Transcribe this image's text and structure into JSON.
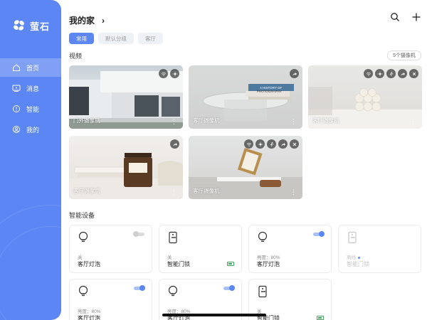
{
  "brand": {
    "name": "萤石",
    "color": "#5b86f3"
  },
  "nav": [
    {
      "label": "首页",
      "icon": "home-icon",
      "active": true
    },
    {
      "label": "消息",
      "icon": "message-icon",
      "active": false
    },
    {
      "label": "智能",
      "icon": "smart-icon",
      "active": false
    },
    {
      "label": "我的",
      "icon": "profile-icon",
      "active": false
    }
  ],
  "header": {
    "title": "我的家",
    "chevron": "›"
  },
  "tabs": [
    {
      "label": "常用",
      "active": true
    },
    {
      "label": "默认分组",
      "active": false
    },
    {
      "label": "客厅",
      "active": false
    }
  ],
  "video": {
    "title": "视频",
    "count": "5个摄像机",
    "cameras": [
      {
        "label": "门外摄像机",
        "icons": [
          "wifi-icon",
          "brightness-icon"
        ]
      },
      {
        "label": "客厅摄像机",
        "icons": [
          "share-icon"
        ]
      },
      {
        "label": "客厅摄像机",
        "icons": [
          "wifi-icon",
          "brightness-icon",
          "motion-icon",
          "share-icon",
          "close-icon"
        ]
      },
      {
        "label": "客厅摄像机",
        "icons": [
          "share-icon"
        ]
      },
      {
        "label": "客厅摄像机",
        "icons": [
          "wifi-icon",
          "brightness-icon",
          "motion-icon",
          "share-icon",
          "close-icon"
        ]
      }
    ],
    "more": "⋮"
  },
  "devices": {
    "title": "智能设备",
    "items": [
      {
        "type": "bulb",
        "state": "关",
        "name": "客厅灯泡",
        "toggle": "off"
      },
      {
        "type": "lock",
        "state": "关",
        "name": "智能门锁",
        "battery": true
      },
      {
        "type": "bulb",
        "state": "亮度：80%",
        "name": "客厅灯泡",
        "toggle": "on"
      },
      {
        "type": "lock",
        "state": "离线",
        "name": "智能门锁",
        "offline": true
      },
      {
        "type": "bulb",
        "state": "亮度：80%",
        "name": "客厅灯泡",
        "toggle": "on"
      },
      {
        "type": "bulb",
        "state": "亮度：80%",
        "name": "客厅灯泡",
        "toggle": "on"
      },
      {
        "type": "lock",
        "state": "关",
        "name": "智能门锁",
        "battery": true
      }
    ]
  }
}
